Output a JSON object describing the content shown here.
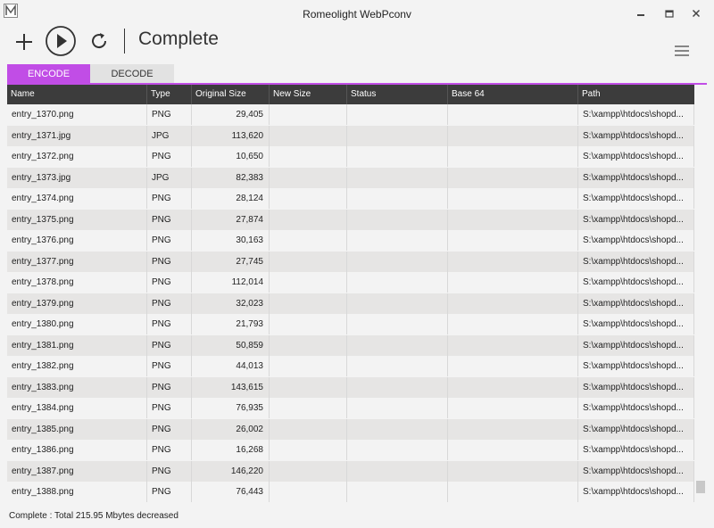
{
  "window": {
    "title": "Romeolight WebPconv"
  },
  "toolbar": {
    "status_title": "Complete"
  },
  "tabs": [
    {
      "label": "ENCODE",
      "active": true
    },
    {
      "label": "DECODE",
      "active": false
    }
  ],
  "accent_color": "#c14de6",
  "columns": [
    "Name",
    "Type",
    "Original Size",
    "New Size",
    "Status",
    "Base 64",
    "Path"
  ],
  "rows": [
    {
      "name": "entry_1370.png",
      "type": "PNG",
      "size": "29,405",
      "path": "S:\\xampp\\htdocs\\shopd..."
    },
    {
      "name": "entry_1371.jpg",
      "type": "JPG",
      "size": "113,620",
      "path": "S:\\xampp\\htdocs\\shopd..."
    },
    {
      "name": "entry_1372.png",
      "type": "PNG",
      "size": "10,650",
      "path": "S:\\xampp\\htdocs\\shopd..."
    },
    {
      "name": "entry_1373.jpg",
      "type": "JPG",
      "size": "82,383",
      "path": "S:\\xampp\\htdocs\\shopd..."
    },
    {
      "name": "entry_1374.png",
      "type": "PNG",
      "size": "28,124",
      "path": "S:\\xampp\\htdocs\\shopd..."
    },
    {
      "name": "entry_1375.png",
      "type": "PNG",
      "size": "27,874",
      "path": "S:\\xampp\\htdocs\\shopd..."
    },
    {
      "name": "entry_1376.png",
      "type": "PNG",
      "size": "30,163",
      "path": "S:\\xampp\\htdocs\\shopd..."
    },
    {
      "name": "entry_1377.png",
      "type": "PNG",
      "size": "27,745",
      "path": "S:\\xampp\\htdocs\\shopd..."
    },
    {
      "name": "entry_1378.png",
      "type": "PNG",
      "size": "112,014",
      "path": "S:\\xampp\\htdocs\\shopd..."
    },
    {
      "name": "entry_1379.png",
      "type": "PNG",
      "size": "32,023",
      "path": "S:\\xampp\\htdocs\\shopd..."
    },
    {
      "name": "entry_1380.png",
      "type": "PNG",
      "size": "21,793",
      "path": "S:\\xampp\\htdocs\\shopd..."
    },
    {
      "name": "entry_1381.png",
      "type": "PNG",
      "size": "50,859",
      "path": "S:\\xampp\\htdocs\\shopd..."
    },
    {
      "name": "entry_1382.png",
      "type": "PNG",
      "size": "44,013",
      "path": "S:\\xampp\\htdocs\\shopd..."
    },
    {
      "name": "entry_1383.png",
      "type": "PNG",
      "size": "143,615",
      "path": "S:\\xampp\\htdocs\\shopd..."
    },
    {
      "name": "entry_1384.png",
      "type": "PNG",
      "size": "76,935",
      "path": "S:\\xampp\\htdocs\\shopd..."
    },
    {
      "name": "entry_1385.png",
      "type": "PNG",
      "size": "26,002",
      "path": "S:\\xampp\\htdocs\\shopd..."
    },
    {
      "name": "entry_1386.png",
      "type": "PNG",
      "size": "16,268",
      "path": "S:\\xampp\\htdocs\\shopd..."
    },
    {
      "name": "entry_1387.png",
      "type": "PNG",
      "size": "146,220",
      "path": "S:\\xampp\\htdocs\\shopd..."
    },
    {
      "name": "entry_1388.png",
      "type": "PNG",
      "size": "76,443",
      "path": "S:\\xampp\\htdocs\\shopd..."
    }
  ],
  "statusbar": {
    "text": "Complete : Total 215.95 Mbytes decreased"
  },
  "icons": [
    "app-logo-icon",
    "minimize-icon",
    "maximize-icon",
    "close-icon",
    "add-icon",
    "play-icon",
    "refresh-icon",
    "hamburger-menu-icon"
  ]
}
